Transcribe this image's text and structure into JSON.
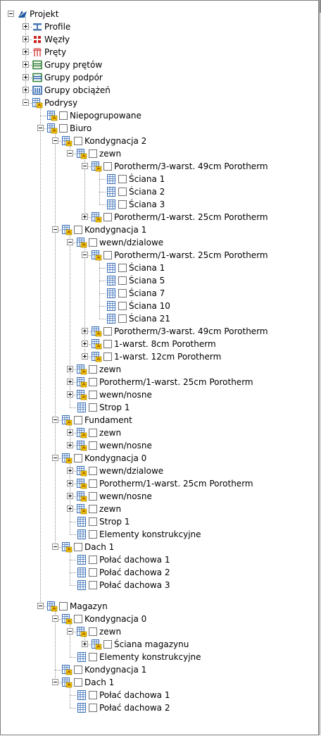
{
  "tree": {
    "root": "Projekt",
    "profile": "Profile",
    "wezly": "Węzły",
    "prety": "Pręty",
    "grupy_pretow": "Grupy prętów",
    "grupy_podpor": "Grupy podpór",
    "grupy_obciazen": "Grupy obciążeń",
    "podrysy": "Podrysy",
    "niepogrupowane": "Niepogrupowane",
    "biuro": "Biuro",
    "kond2": "Kondygnacja 2",
    "k2_zewn": "zewn",
    "k2_z_p3": "Porotherm/3-warst. 49cm Porotherm",
    "k2_s1": "Ściana 1",
    "k2_s2": "Ściana 2",
    "k2_s3": "Ściana 3",
    "k2_z_p1": "Porotherm/1-warst. 25cm Porotherm",
    "kond1": "Kondygnacja 1",
    "k1_wd": "wewn/dzialowe",
    "k1_wd_p1": "Porotherm/1-warst. 25cm Porotherm",
    "k1_s1": "Ściana 1",
    "k1_s5": "Ściana 5",
    "k1_s7": "Ściana 7",
    "k1_s10": "Ściana 10",
    "k1_s21": "Ściana 21",
    "k1_wd_p3": "Porotherm/3-warst. 49cm Porotherm",
    "k1_wd_8": "1-warst. 8cm Porotherm",
    "k1_wd_12": "1-warst. 12cm Porotherm",
    "k1_zewn": "zewn",
    "k1_p1": "Porotherm/1-warst. 25cm Porotherm",
    "k1_wn": "wewn/nosne",
    "k1_strop": "Strop 1",
    "fund": "Fundament",
    "f_zewn": "zewn",
    "f_wn": "wewn/nosne",
    "kond0": "Kondygnacja 0",
    "k0_wd": "wewn/dzialowe",
    "k0_p1": "Porotherm/1-warst. 25cm Porotherm",
    "k0_wn": "wewn/nosne",
    "k0_zewn": "zewn",
    "k0_strop": "Strop 1",
    "k0_ek": "Elementy konstrukcyjne",
    "dach1": "Dach 1",
    "d_p1": "Połać dachowa 1",
    "d_p2": "Połać dachowa 2",
    "d_p3": "Połać dachowa 3",
    "magazyn": "Magazyn",
    "m_k0": "Kondygnacja 0",
    "m_k0_zewn": "zewn",
    "m_k0_sciana": "Ściana magazynu",
    "m_k0_ek": "Elementy konstrukcyjne",
    "m_k1": "Kondygnacja 1",
    "m_dach": "Dach 1",
    "m_d_p1": "Połać dachowa 1",
    "m_d_p2": "Połać dachowa 2"
  },
  "colors": {
    "wall_blue": "#3a6fb8",
    "folder_yellow": "#f2c200",
    "node_red": "#cc2222",
    "group_green": "#2e7d32",
    "support_blue": "#1e5aa8"
  },
  "rows": [
    {
      "level": 0,
      "exp": "minus",
      "icon": "project-icon",
      "cb": false,
      "key": "root"
    },
    {
      "level": 1,
      "exp": "plus",
      "icon": "profile-icon",
      "cb": false,
      "key": "profile"
    },
    {
      "level": 1,
      "exp": "plus",
      "icon": "nodes-icon",
      "cb": false,
      "key": "wezly"
    },
    {
      "level": 1,
      "exp": "plus",
      "icon": "bars-icon",
      "cb": false,
      "key": "prety"
    },
    {
      "level": 1,
      "exp": "plus",
      "icon": "bar-group-icon",
      "cb": false,
      "key": "grupy_pretow"
    },
    {
      "level": 1,
      "exp": "plus",
      "icon": "support-group-icon",
      "cb": false,
      "key": "grupy_podpor"
    },
    {
      "level": 1,
      "exp": "plus",
      "icon": "load-group-icon",
      "cb": false,
      "key": "grupy_obciazen"
    },
    {
      "level": 1,
      "exp": "minus",
      "icon": "subdrawing-folder-icon",
      "cb": false,
      "key": "podrysy"
    },
    {
      "level": 2,
      "exp": null,
      "icon": "subdrawing-folder-icon",
      "cb": true,
      "key": "niepogrupowane"
    },
    {
      "level": 2,
      "exp": "minus",
      "icon": "subdrawing-folder-icon",
      "cb": true,
      "key": "biuro"
    },
    {
      "level": 3,
      "exp": "minus",
      "icon": "subdrawing-folder-icon",
      "cb": true,
      "key": "kond2"
    },
    {
      "level": 4,
      "exp": "minus",
      "icon": "subdrawing-folder-icon",
      "cb": true,
      "key": "k2_zewn"
    },
    {
      "level": 5,
      "exp": "minus",
      "icon": "subdrawing-folder-icon",
      "cb": true,
      "key": "k2_z_p3"
    },
    {
      "level": 6,
      "exp": null,
      "icon": "wall-grid-icon",
      "cb": true,
      "key": "k2_s1"
    },
    {
      "level": 6,
      "exp": null,
      "icon": "wall-grid-icon",
      "cb": true,
      "key": "k2_s2"
    },
    {
      "level": 6,
      "exp": null,
      "icon": "wall-grid-icon",
      "cb": true,
      "key": "k2_s3"
    },
    {
      "level": 5,
      "exp": "plus",
      "icon": "subdrawing-folder-icon",
      "cb": true,
      "key": "k2_z_p1"
    },
    {
      "level": 3,
      "exp": "minus",
      "icon": "subdrawing-folder-icon",
      "cb": true,
      "key": "kond1"
    },
    {
      "level": 4,
      "exp": "minus",
      "icon": "subdrawing-folder-icon",
      "cb": true,
      "key": "k1_wd"
    },
    {
      "level": 5,
      "exp": "minus",
      "icon": "subdrawing-folder-icon",
      "cb": true,
      "key": "k1_wd_p1"
    },
    {
      "level": 6,
      "exp": null,
      "icon": "wall-grid-icon",
      "cb": true,
      "key": "k1_s1"
    },
    {
      "level": 6,
      "exp": null,
      "icon": "wall-grid-icon",
      "cb": true,
      "key": "k1_s5"
    },
    {
      "level": 6,
      "exp": null,
      "icon": "wall-grid-icon",
      "cb": true,
      "key": "k1_s7"
    },
    {
      "level": 6,
      "exp": null,
      "icon": "wall-grid-icon",
      "cb": true,
      "key": "k1_s10"
    },
    {
      "level": 6,
      "exp": null,
      "icon": "wall-grid-icon",
      "cb": true,
      "key": "k1_s21"
    },
    {
      "level": 5,
      "exp": "plus",
      "icon": "subdrawing-folder-icon",
      "cb": true,
      "key": "k1_wd_p3"
    },
    {
      "level": 5,
      "exp": "plus",
      "icon": "subdrawing-folder-icon",
      "cb": true,
      "key": "k1_wd_8"
    },
    {
      "level": 5,
      "exp": "plus",
      "icon": "subdrawing-folder-icon",
      "cb": true,
      "key": "k1_wd_12"
    },
    {
      "level": 4,
      "exp": "plus",
      "icon": "subdrawing-folder-icon",
      "cb": true,
      "key": "k1_zewn"
    },
    {
      "level": 4,
      "exp": "plus",
      "icon": "subdrawing-folder-icon",
      "cb": true,
      "key": "k1_p1"
    },
    {
      "level": 4,
      "exp": "plus",
      "icon": "subdrawing-folder-icon",
      "cb": true,
      "key": "k1_wn"
    },
    {
      "level": 4,
      "exp": null,
      "icon": "wall-grid-icon",
      "cb": true,
      "key": "k1_strop"
    },
    {
      "level": 3,
      "exp": "minus",
      "icon": "subdrawing-folder-icon",
      "cb": true,
      "key": "fund"
    },
    {
      "level": 4,
      "exp": "plus",
      "icon": "subdrawing-folder-icon",
      "cb": true,
      "key": "f_zewn"
    },
    {
      "level": 4,
      "exp": "plus",
      "icon": "subdrawing-folder-icon",
      "cb": true,
      "key": "f_wn"
    },
    {
      "level": 3,
      "exp": "minus",
      "icon": "subdrawing-folder-icon",
      "cb": true,
      "key": "kond0"
    },
    {
      "level": 4,
      "exp": "plus",
      "icon": "subdrawing-folder-icon",
      "cb": true,
      "key": "k0_wd"
    },
    {
      "level": 4,
      "exp": "plus",
      "icon": "subdrawing-folder-icon",
      "cb": true,
      "key": "k0_p1"
    },
    {
      "level": 4,
      "exp": "plus",
      "icon": "subdrawing-folder-icon",
      "cb": true,
      "key": "k0_wn"
    },
    {
      "level": 4,
      "exp": "plus",
      "icon": "subdrawing-folder-icon",
      "cb": true,
      "key": "k0_zewn"
    },
    {
      "level": 4,
      "exp": null,
      "icon": "wall-grid-icon",
      "cb": true,
      "key": "k0_strop"
    },
    {
      "level": 4,
      "exp": null,
      "icon": "wall-grid-icon",
      "cb": true,
      "key": "k0_ek"
    },
    {
      "level": 3,
      "exp": "minus",
      "icon": "subdrawing-folder-icon",
      "cb": true,
      "key": "dach1"
    },
    {
      "level": 4,
      "exp": null,
      "icon": "wall-grid-icon",
      "cb": true,
      "key": "d_p1"
    },
    {
      "level": 4,
      "exp": null,
      "icon": "wall-grid-icon",
      "cb": true,
      "key": "d_p2"
    },
    {
      "level": 4,
      "exp": null,
      "icon": "wall-grid-icon",
      "cb": true,
      "key": "d_p3"
    },
    {
      "level": 2,
      "exp": "minus",
      "icon": "subdrawing-folder-icon",
      "cb": true,
      "key": "magazyn",
      "gap": 12
    },
    {
      "level": 3,
      "exp": "minus",
      "icon": "subdrawing-folder-icon",
      "cb": true,
      "key": "m_k0"
    },
    {
      "level": 4,
      "exp": "minus",
      "icon": "subdrawing-folder-icon",
      "cb": true,
      "key": "m_k0_zewn"
    },
    {
      "level": 5,
      "exp": "plus",
      "icon": "subdrawing-folder-icon",
      "cb": true,
      "key": "m_k0_sciana"
    },
    {
      "level": 4,
      "exp": null,
      "icon": "wall-grid-icon",
      "cb": true,
      "key": "m_k0_ek"
    },
    {
      "level": 3,
      "exp": null,
      "icon": "subdrawing-folder-icon",
      "cb": true,
      "key": "m_k1"
    },
    {
      "level": 3,
      "exp": "minus",
      "icon": "subdrawing-folder-icon",
      "cb": true,
      "key": "m_dach"
    },
    {
      "level": 4,
      "exp": null,
      "icon": "wall-grid-icon",
      "cb": true,
      "key": "m_d_p1"
    },
    {
      "level": 4,
      "exp": null,
      "icon": "wall-grid-icon",
      "cb": true,
      "key": "m_d_p2"
    }
  ]
}
